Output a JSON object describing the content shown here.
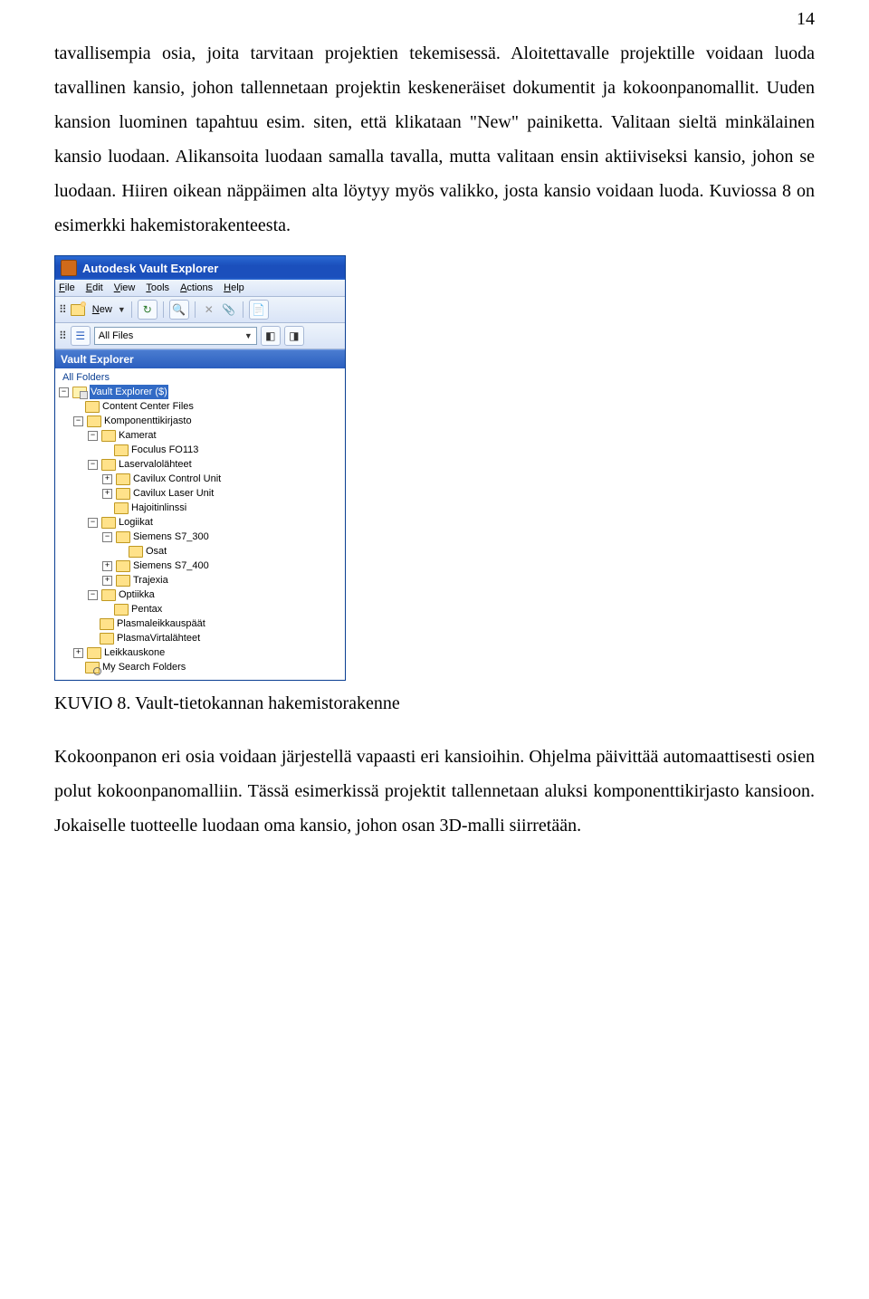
{
  "page_number": "14",
  "paragraphs": {
    "p1": "tavallisempia osia, joita tarvitaan projektien tekemisessä. Aloitettavalle projektille voidaan luoda tavallinen kansio, johon tallennetaan projektin keskeneräiset dokumentit ja kokoonpanomallit. Uuden kansion luominen tapahtuu esim. siten, että klikataan \"New\" painiketta. Valitaan sieltä minkälainen kansio luodaan. Alikansoita luodaan samalla tavalla, mutta valitaan ensin aktiiviseksi kansio, johon se luodaan. Hiiren oikean näppäimen alta löytyy myös valikko, josta kansio voidaan luoda. Kuviossa 8 on esimerkki hakemistorakenteesta.",
    "p2": "Kokoonpanon eri osia voidaan järjestellä vapaasti eri kansioihin. Ohjelma päivittää automaattisesti osien polut kokoonpanomalliin. Tässä esimerkissä projektit tallennetaan aluksi komponenttikirjasto kansioon. Jokaiselle tuotteelle luodaan oma kansio, johon osan 3D-malli siirretään."
  },
  "caption": "KUVIO 8. Vault-tietokannan hakemistorakenne",
  "app": {
    "title": "Autodesk Vault Explorer",
    "menus": [
      "File",
      "Edit",
      "View",
      "Tools",
      "Actions",
      "Help"
    ],
    "new_label": "New",
    "combo_value": "All Files",
    "pane_title": "Vault Explorer",
    "all_folders": "All Folders",
    "tree": {
      "root": "Vault Explorer ($)",
      "n0": "Content Center Files",
      "n1": "Komponenttikirjasto",
      "n1_0": "Kamerat",
      "n1_0_0": "Foculus FO113",
      "n1_1": "Laservalolähteet",
      "n1_1_0": "Cavilux Control Unit",
      "n1_1_1": "Cavilux Laser Unit",
      "n1_1_2": "Hajoitinlinssi",
      "n1_2": "Logiikat",
      "n1_2_0": "Siemens S7_300",
      "n1_2_0_0": "Osat",
      "n1_2_1": "Siemens S7_400",
      "n1_2_2": "Trajexia",
      "n1_3": "Optiikka",
      "n1_3_0": "Pentax",
      "n1_4": "Plasmaleikkauspäät",
      "n1_5": "PlasmaVirtalähteet",
      "n2": "Leikkauskone",
      "n3": "My Search Folders"
    }
  }
}
